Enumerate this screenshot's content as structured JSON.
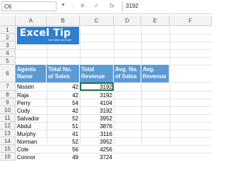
{
  "formula_bar": {
    "name_box": "C6",
    "cancel": "✕",
    "enter": "✓",
    "fx": "fx",
    "value": "3192"
  },
  "columns": [
    "A",
    "B",
    "C",
    "D",
    "E",
    "F"
  ],
  "rows": [
    "1",
    "2",
    "3",
    "4",
    "5",
    "6",
    "7",
    "8",
    "9",
    "10",
    "11",
    "12",
    "13",
    "14",
    "15",
    "16"
  ],
  "logo": {
    "text": "Excel Tip",
    "tagline": "Get better at Excel"
  },
  "table": {
    "headers": [
      "Agents Name",
      "Total No. of Sales",
      "Total Revenue",
      "Avg. No. of Sales",
      "Avg. Revenue"
    ],
    "rows": [
      [
        "Nissim",
        "42",
        "3192",
        "",
        ""
      ],
      [
        "Raja",
        "42",
        "3192",
        "",
        ""
      ],
      [
        "Perry",
        "54",
        "4104",
        "",
        ""
      ],
      [
        "Cody",
        "42",
        "3192",
        "",
        ""
      ],
      [
        "Salvador",
        "52",
        "3952",
        "",
        ""
      ],
      [
        "Abdul",
        "51",
        "3876",
        "",
        ""
      ],
      [
        "Murphy",
        "41",
        "3116",
        "",
        ""
      ],
      [
        "Norman",
        "52",
        "3952",
        "",
        ""
      ],
      [
        "Cole",
        "56",
        "4256",
        "",
        ""
      ],
      [
        "Connor",
        "49",
        "3724",
        "",
        ""
      ]
    ]
  },
  "colors": {
    "header_fill": "#5b9bd5",
    "logo_fill": "#2f7fce",
    "selection": "#1e7145"
  }
}
